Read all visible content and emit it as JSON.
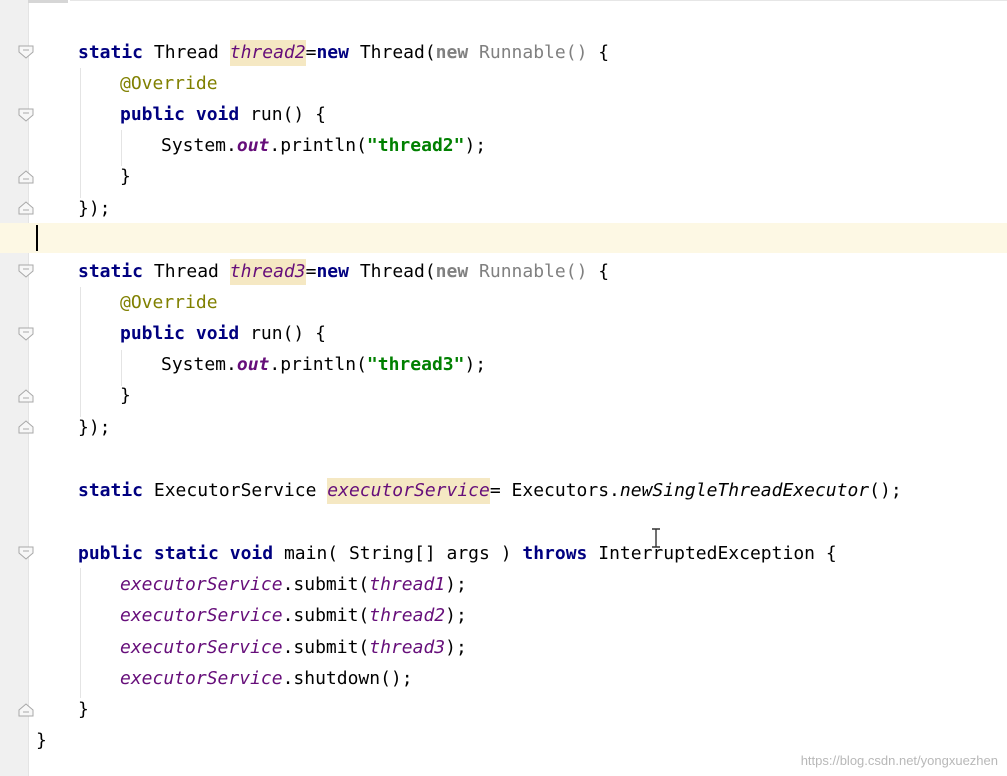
{
  "code": {
    "thread2_decl": {
      "static": "static",
      "type": "Thread",
      "name": "thread2",
      "eq": "=",
      "new1": "new",
      "thread_call": "Thread(",
      "new2": "new",
      "runnable": "Runnable()",
      "brace": " {"
    },
    "override": "@Override",
    "run_decl": {
      "public": "public",
      "void": "void",
      "rest": "run() {"
    },
    "println1": {
      "prefix": "System.",
      "out": "out",
      "method": ".println(",
      "str": "\"thread2\"",
      "end": ");"
    },
    "close_brace": "}",
    "close_anon": "});",
    "thread3_decl": {
      "static": "static",
      "type": "Thread",
      "name": "thread3",
      "eq": "=",
      "new1": "new",
      "thread_call": "Thread(",
      "new2": "new",
      "runnable": "Runnable()",
      "brace": " {"
    },
    "println2": {
      "prefix": "System.",
      "out": "out",
      "method": ".println(",
      "str": "\"thread3\"",
      "end": ");"
    },
    "executor_decl": {
      "static": "static",
      "type": "ExecutorService",
      "name": "executorService",
      "rest_prefix": "= Executors.",
      "factory": "newSingleThreadExecutor",
      "end": "();"
    },
    "main_decl": {
      "public": "public",
      "static": "static",
      "void": "void",
      "sig": "main( String[] args )",
      "throws": "throws",
      "exc": "InterruptedException {"
    },
    "submit1": {
      "field": "executorService",
      "method": ".submit(",
      "arg": "thread1",
      "end": ");"
    },
    "submit2": {
      "field": "executorService",
      "method": ".submit(",
      "arg": "thread2",
      "end": ");"
    },
    "submit3": {
      "field": "executorService",
      "method": ".submit(",
      "arg": "thread3",
      "end": ");"
    },
    "shutdown": {
      "field": "executorService",
      "method": ".shutdown();"
    },
    "method_close": "}",
    "class_close": "}"
  },
  "watermark": "https://blog.csdn.net/yongxuezhen",
  "colors": {
    "keyword": "#000080",
    "string": "#008000",
    "field": "#660e7a",
    "annotation": "#808000",
    "highlight": "#f5e8c3",
    "current_line": "#fdf8e4"
  }
}
